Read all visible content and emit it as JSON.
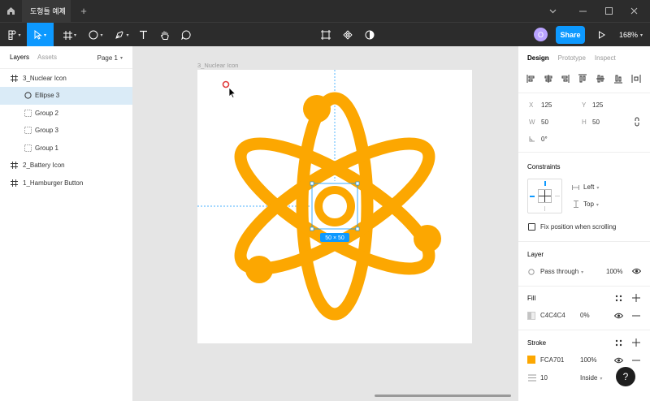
{
  "titlebar": {
    "tab_label": "도형틀 예제",
    "close_glyph": "✕",
    "newtab_glyph": "+"
  },
  "toolbar": {
    "share_label": "Share",
    "zoom_label": "168%",
    "avatar_initial": "O"
  },
  "left_panel": {
    "tabs": [
      "Layers",
      "Assets"
    ],
    "page_label": "Page 1",
    "layers": [
      {
        "label": "3_Nuclear Icon",
        "type": "frame",
        "indent": 0,
        "selected": false
      },
      {
        "label": "Ellipse 3",
        "type": "ellipse",
        "indent": 1,
        "selected": true
      },
      {
        "label": "Group 2",
        "type": "group",
        "indent": 1,
        "selected": false
      },
      {
        "label": "Group 3",
        "type": "group",
        "indent": 1,
        "selected": false
      },
      {
        "label": "Group 1",
        "type": "group",
        "indent": 1,
        "selected": false
      },
      {
        "label": "2_Battery Icon",
        "type": "frame",
        "indent": 0,
        "selected": false
      },
      {
        "label": "1_Hamburger Button",
        "type": "frame",
        "indent": 0,
        "selected": false
      }
    ]
  },
  "canvas": {
    "frame_label": "3_Nuclear Icon",
    "selection_badge": "50 × 50",
    "colors": {
      "orange": "#FCA701",
      "selection": "#0d99ff"
    }
  },
  "right_panel": {
    "tabs": [
      "Design",
      "Prototype",
      "Inspect"
    ],
    "position": {
      "x_label": "X",
      "x_value": "125",
      "y_label": "Y",
      "y_value": "125",
      "w_label": "W",
      "w_value": "50",
      "h_label": "H",
      "h_value": "50",
      "rotation": "0°"
    },
    "constraints": {
      "title": "Constraints",
      "horizontal": "Left",
      "vertical": "Top",
      "fix_label": "Fix position when scrolling"
    },
    "layer": {
      "title": "Layer",
      "blend": "Pass through",
      "opacity": "100%"
    },
    "fill": {
      "title": "Fill",
      "hex": "C4C4C4",
      "opacity": "0%",
      "color": "#C4C4C4"
    },
    "stroke": {
      "title": "Stroke",
      "hex": "FCA701",
      "opacity": "100%",
      "weight": "10",
      "position": "Inside",
      "color": "#FCA701"
    }
  },
  "help_glyph": "?"
}
